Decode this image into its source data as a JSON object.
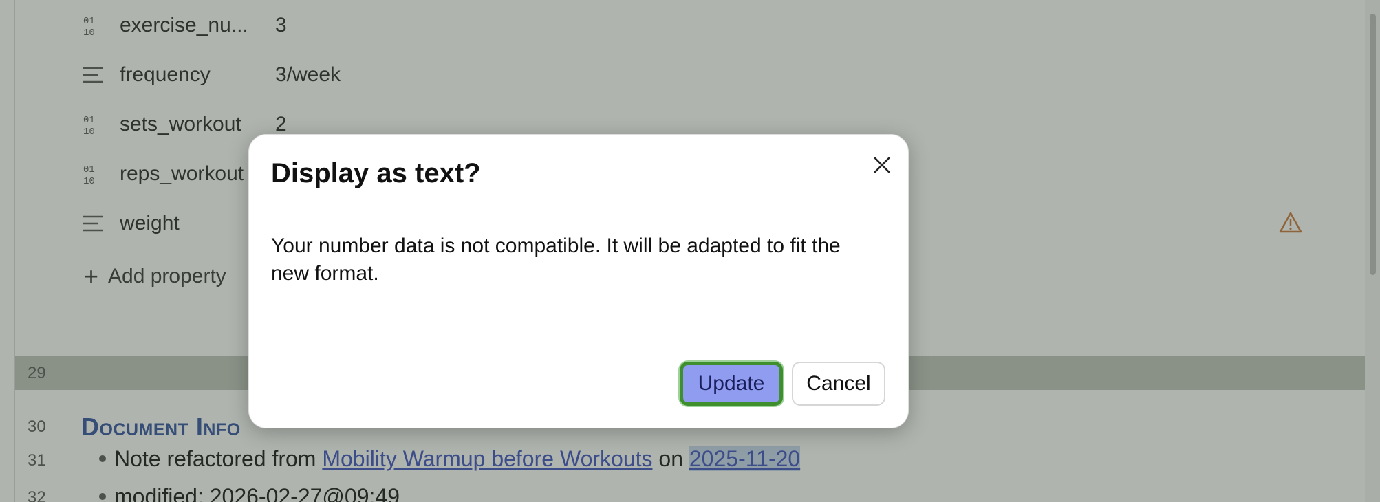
{
  "properties": [
    {
      "icon": "number-icon",
      "name": "exercise_nu...",
      "value": "3"
    },
    {
      "icon": "text-icon",
      "name": "frequency",
      "value": "3/week"
    },
    {
      "icon": "number-icon",
      "name": "sets_workout",
      "value": "2"
    },
    {
      "icon": "number-icon",
      "name": "reps_workout",
      "value": ""
    },
    {
      "icon": "text-icon",
      "name": "weight",
      "value": ""
    }
  ],
  "add_property_label": "Add property",
  "lines": {
    "n29": "29",
    "n30": "30",
    "n31": "31",
    "n32": "32"
  },
  "heading": "Document Info",
  "note": {
    "prefix": "Note refactored from ",
    "link": "Mobility Warmup before Workouts",
    "mid": " on ",
    "date": "2025-11-20"
  },
  "modified": "modified: 2026-02-27@09:49",
  "dialog": {
    "title": "Display as text?",
    "message": "Your number data is not compatible. It will be adapted to fit the new format.",
    "update_label": "Update",
    "cancel_label": "Cancel"
  },
  "colors": {
    "heading": "#2f4fa2",
    "link": "#3a4fc1",
    "update_button": "#8f9cf0",
    "focus_ring": "#3f8f2f",
    "warning": "#c8763a"
  }
}
